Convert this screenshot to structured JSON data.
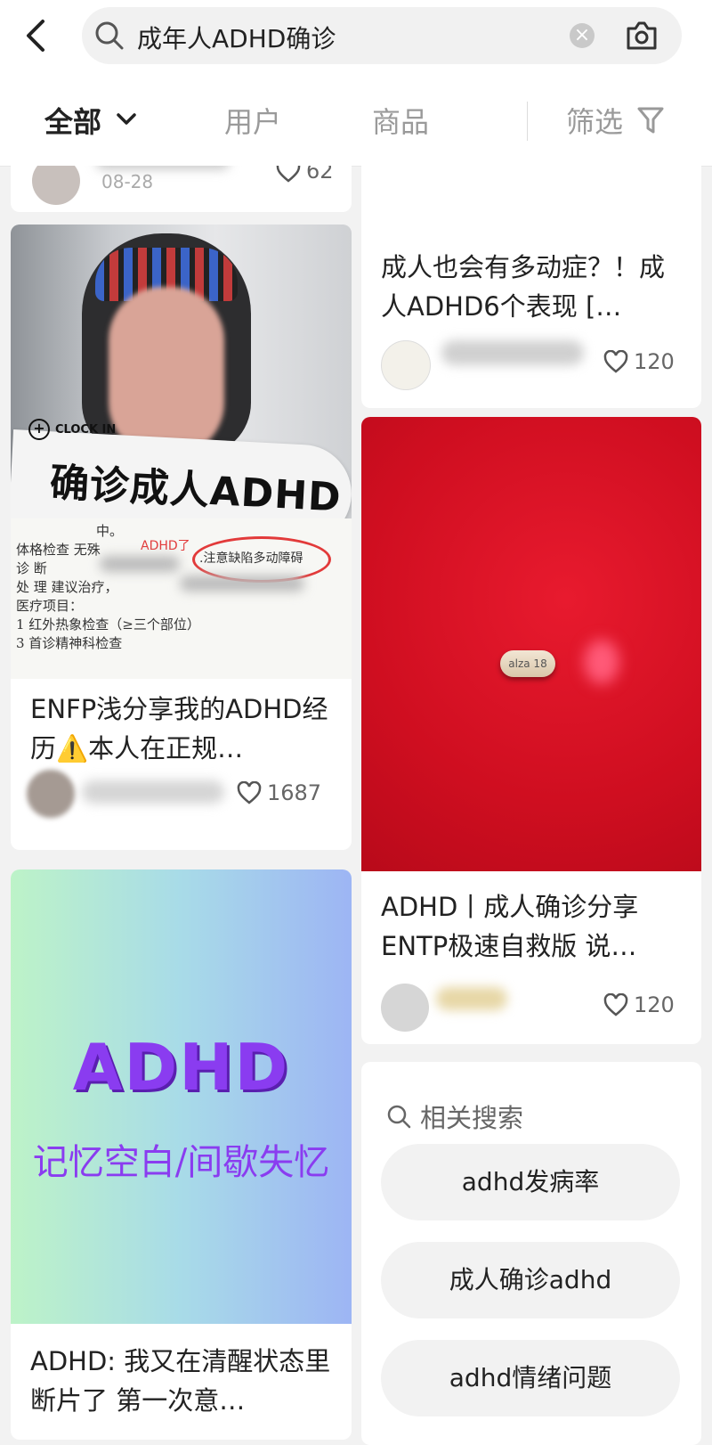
{
  "search": {
    "query": "成年人ADHD确诊"
  },
  "tabs": [
    "全部",
    "用户",
    "商品",
    "筛选"
  ],
  "left_cards": [
    {
      "date": "08-28",
      "likes": "62"
    },
    {
      "overlay_badge": "CLOCK IN",
      "overlay_title": "确诊成人ADHD",
      "doc_lines": [
        "中。",
        "体格检查   无殊",
        "诊    断",
        "处    理    建议治疗，",
        "医疗项目：",
        "1  红外热象检查（≥三个部位）",
        "3  首诊精神科检查"
      ],
      "annotation": "ADHD了",
      "highlight": ".注意缺陷多动障碍",
      "title": "ENFP浅分享我的ADHD经历⚠️本人在正规…",
      "likes": "1687"
    },
    {
      "cover_big": "ADHD",
      "cover_sub": "记忆空白/间歇失忆",
      "title": "ADHD: 我又在清醒状态里断片了 第一次意…"
    }
  ],
  "right_cards": [
    {
      "title": "成人也会有多动症？！成人ADHD6个表现 […",
      "likes": "120"
    },
    {
      "pill_text": "alza 18",
      "title": "ADHD丨成人确诊分享ENTP极速自救版 说…",
      "likes": "120"
    }
  ],
  "related": {
    "label": "相关搜索",
    "items": [
      "adhd发病率",
      "成人确诊adhd",
      "adhd情绪问题"
    ]
  },
  "colors": {
    "accent": "#ff2442",
    "red_cover": "#d10f22",
    "gradient_start": "#bdf3c8",
    "gradient_end": "#9db5f4"
  }
}
